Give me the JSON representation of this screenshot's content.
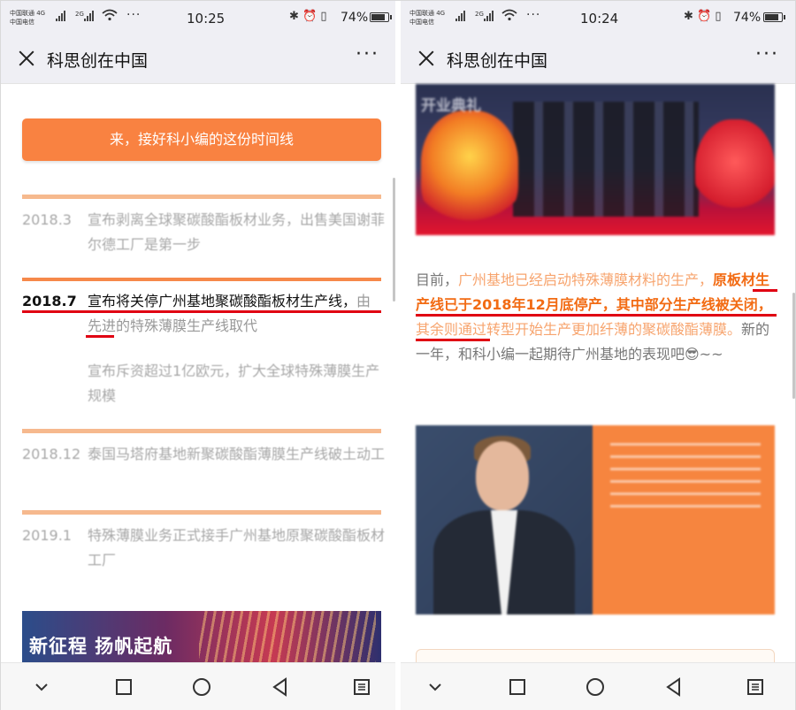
{
  "left": {
    "status": {
      "carrier_line1": "中国联通 4G",
      "carrier_line2": "中国电信",
      "net": "2G",
      "time": "10:25",
      "battery": "74%",
      "battery_level": 0.74
    },
    "title": "科思创在中国",
    "cta_label": "来，接好科小编的这份时间线",
    "timeline": [
      {
        "year": "2018.3",
        "text": "宣布剥离全球聚碳酸酯板材业务，出售美国谢菲尔德工厂是第一步"
      },
      {
        "year": "2018.7",
        "text_main": "宣布将关停广州基地聚碳酸酯板材生产线，",
        "text_sub": "由先进的特殊薄膜生产线取代"
      },
      {
        "year": "",
        "text": "宣布斥资超过1亿欧元，扩大全球特殊薄膜生产规模"
      },
      {
        "year": "2018.12",
        "text": "泰国马塔府基地新聚碳酸酯薄膜生产线破土动工"
      },
      {
        "year": "2019.1",
        "text": "特殊薄膜业务正式接手广州基地原聚碳酸酯板材工厂"
      }
    ],
    "banner_title": "新征程  扬帆起航"
  },
  "right": {
    "status": {
      "carrier_line1": "中国联通 4G",
      "carrier_line2": "中国电信",
      "net": "2G",
      "time": "10:24",
      "battery": "74%",
      "battery_level": 0.74
    },
    "title": "科思创在中国",
    "photo1_caption": "开业典礼",
    "paragraph": {
      "p1": "目前，",
      "p2": "广州基地已经启动特殊薄膜材料的生产，",
      "p3": "原板材生产线已于2018年12月底停产，其中部分生产线被关闭，",
      "p4": "其余则通过转型开始生产更加纤薄的聚碳酸酯薄膜。",
      "p5": "新的一年，和科小编一起期待广州基地的表现吧😎~~"
    }
  }
}
